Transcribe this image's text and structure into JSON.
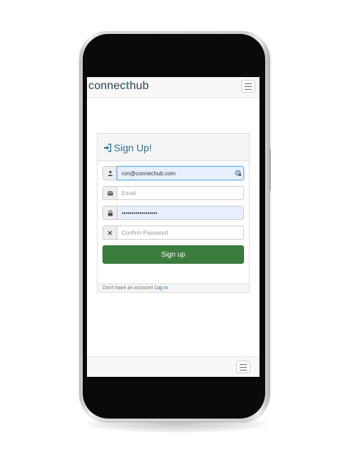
{
  "brand": {
    "part1": "connec",
    "accent": "t",
    "part2": "hub"
  },
  "icons": {
    "brand_accent_color": "#3a9a6a",
    "primary_button_color": "#3b7d3c",
    "title_color": "#2f6f94",
    "signin_icon": "sign-in-icon",
    "username_icon": "user-icon",
    "email_icon": "envelope-icon",
    "password_icon": "lock-icon",
    "confirm_icon": "times-icon",
    "menu_icon": "hamburger-icon"
  },
  "form": {
    "title": "Sign Up!",
    "username": {
      "value": "ron@connechub.com",
      "placeholder": ""
    },
    "email": {
      "value": "",
      "placeholder": "Email"
    },
    "password": {
      "value": "••••••••••••••••••",
      "placeholder": ""
    },
    "confirm_password": {
      "value": "",
      "placeholder": "Confirm Password"
    },
    "submit_label": "Sign up",
    "footer_text": "Don't have an account! ",
    "footer_link": "Log in"
  }
}
